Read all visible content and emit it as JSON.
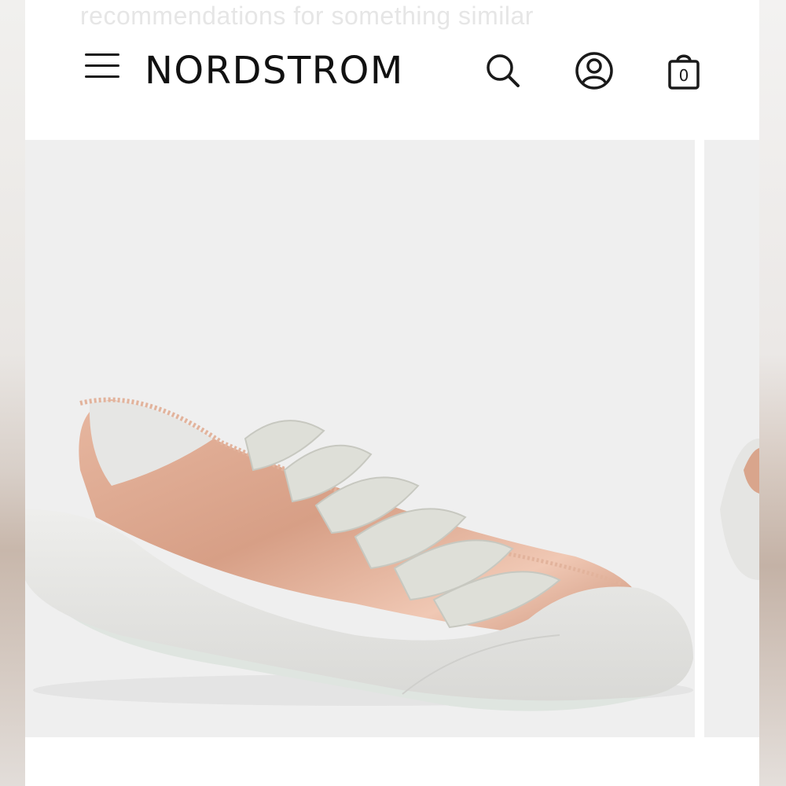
{
  "background_text": "recommendations for something similar",
  "header": {
    "logo": "NORDSTROM",
    "menu_icon": "hamburger-menu-icon",
    "search_icon": "search-icon",
    "account_icon": "account-icon",
    "bag_icon": "shopping-bag-icon",
    "bag_count": "0"
  },
  "product": {
    "image_subject": "rose-gold satin low-top lace-up sneaker with frayed edges and white suede rubber sole",
    "colors": {
      "satin": "#d9a58c",
      "sole": "#e8e8e6",
      "laces": "#dcdcd6"
    }
  }
}
